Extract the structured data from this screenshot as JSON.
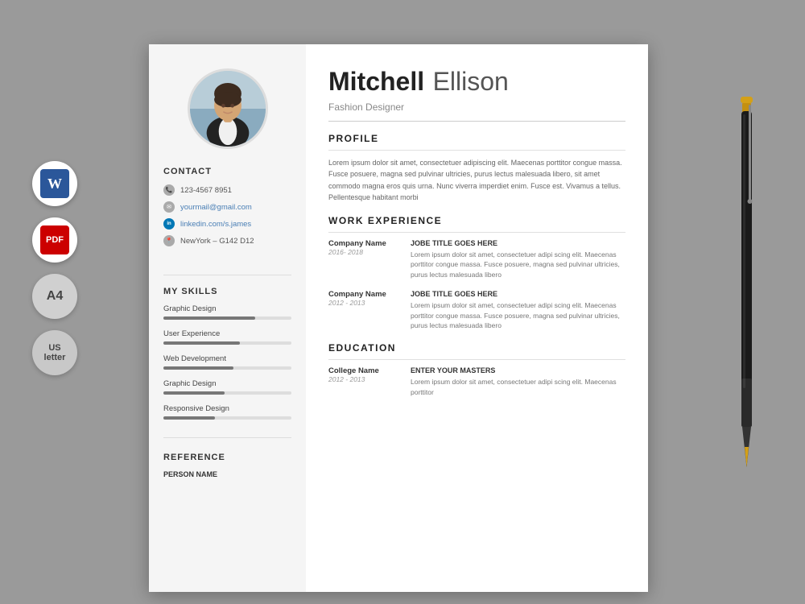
{
  "page": {
    "background_color": "#9a9a9a"
  },
  "side_icons": {
    "word_label": "W",
    "pdf_label": "PDF",
    "a4_label": "A4",
    "us_line1": "US",
    "us_line2": "letter"
  },
  "resume": {
    "left": {
      "contact_section_title": "CONTACT",
      "phone": "123-4567 8951",
      "email": "yourmail@gmail.com",
      "linkedin": "linkedin.com/s.james",
      "location": "NewYork – G142 D12",
      "skills_section_title": "MY SKILLS",
      "skills": [
        {
          "name": "Graphic Design",
          "percent": 72
        },
        {
          "name": "User Experience",
          "percent": 60
        },
        {
          "name": "Web Development",
          "percent": 55
        },
        {
          "name": "Graphic Design",
          "percent": 48
        },
        {
          "name": "Responsive Design",
          "percent": 40
        }
      ],
      "reference_section_title": "REFERENCE",
      "person_name_label": "PERSON NAME"
    },
    "right": {
      "first_name": "Mitchell",
      "last_name": "Ellison",
      "job_title": "Fashion Designer",
      "sections": {
        "profile": {
          "title": "PROFILE",
          "text": "Lorem ipsum dolor sit amet, consectetuer adipiscing elit. Maecenas porttitor congue massa. Fusce posuere, magna sed pulvinar ultricies, purus lectus malesuada libero, sit amet commodo magna eros quis urna. Nunc viverra imperdiet enim. Fusce est. Vivamus a tellus. Pellentesque habitant morbi"
        },
        "work_experience": {
          "title": "WORK EXPERIENCE",
          "entries": [
            {
              "company": "Company Name",
              "dates": "2016- 2018",
              "job_title": "JOBE TITLE GOES HERE",
              "description": "Lorem ipsum dolor sit amet, consectetuer adipi scing elit. Maecenas porttitor congue massa. Fusce posuere, magna sed pulvinar ultricies, purus lectus malesuada libero"
            },
            {
              "company": "Company Name",
              "dates": "2012 - 2013",
              "job_title": "JOBE TITLE GOES HERE",
              "description": "Lorem ipsum dolor sit amet, consectetuer adipi scing elit. Maecenas porttitor congue massa. Fusce posuere, magna sed pulvinar ultricies, purus lectus malesuada libero"
            }
          ]
        },
        "education": {
          "title": "EDUCATION",
          "entries": [
            {
              "college": "College Name",
              "dates": "2012 - 2013",
              "degree_title": "ENTER YOUR MASTERS",
              "description": "Lorem ipsum dolor sit amet, consectetuer adipi scing elit. Maecenas porttitor"
            }
          ]
        }
      }
    }
  }
}
